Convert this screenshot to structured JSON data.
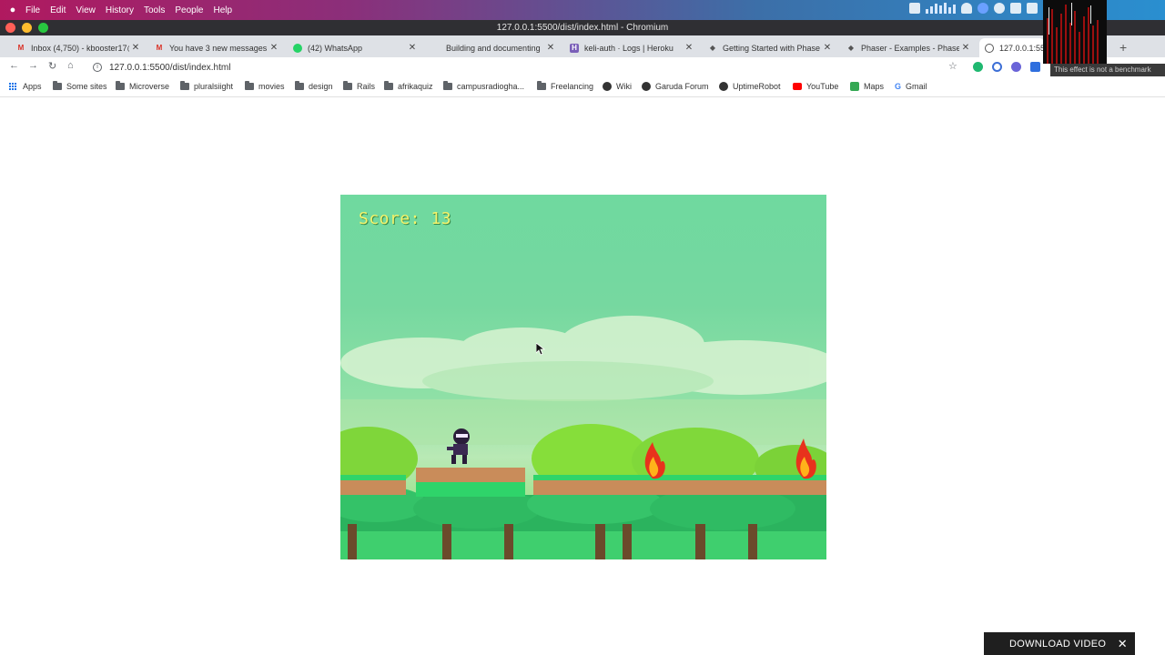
{
  "menubar": {
    "items": [
      "File",
      "Edit",
      "View",
      "History",
      "Tools",
      "People",
      "Help"
    ]
  },
  "window": {
    "title": "127.0.0.1:5500/dist/index.html - Chromium"
  },
  "tabs": [
    {
      "label": "Inbox (4,750) - kbooster17@",
      "icon": "gmail-icon"
    },
    {
      "label": "You have 3 new messages",
      "icon": "gmail-icon"
    },
    {
      "label": "(42) WhatsApp",
      "icon": "whatsapp-icon"
    },
    {
      "label": "Building and documenting",
      "icon": "blank-icon"
    },
    {
      "label": "keli-auth · Logs | Heroku",
      "icon": "heroku-icon"
    },
    {
      "label": "Getting Started with Phase",
      "icon": "phaser-icon"
    },
    {
      "label": "Phaser - Examples - Phaser",
      "icon": "phaser-icon"
    },
    {
      "label": "127.0.0.1:550",
      "icon": "globe-icon"
    }
  ],
  "toolbar": {
    "url": "127.0.0.1:5500/dist/index.html"
  },
  "bookmarks": [
    {
      "label": "Apps",
      "icon": "apps-grid-icon"
    },
    {
      "label": "Some sites",
      "icon": "folder-icon"
    },
    {
      "label": "Microverse",
      "icon": "folder-icon"
    },
    {
      "label": "pluralsiight",
      "icon": "folder-icon"
    },
    {
      "label": "movies",
      "icon": "folder-icon"
    },
    {
      "label": "design",
      "icon": "folder-icon"
    },
    {
      "label": "Rails",
      "icon": "folder-icon"
    },
    {
      "label": "afrikaquiz",
      "icon": "folder-icon"
    },
    {
      "label": "campusradiogha...",
      "icon": "folder-icon"
    },
    {
      "label": "Freelancing",
      "icon": "folder-icon"
    },
    {
      "label": "Wiki",
      "icon": "globe-icon"
    },
    {
      "label": "Garuda Forum",
      "icon": "globe-icon"
    },
    {
      "label": "UptimeRobot",
      "icon": "globe-icon"
    },
    {
      "label": "YouTube",
      "icon": "youtube-icon"
    },
    {
      "label": "Maps",
      "icon": "maps-icon"
    },
    {
      "label": "Gmail",
      "icon": "google-icon"
    }
  ],
  "game": {
    "score_text": "Score: 13"
  },
  "visualizer": {
    "tooltip": "This effect is not a benchmark"
  },
  "download": {
    "label": "DOWNLOAD VIDEO",
    "close": "✕"
  },
  "colors": {
    "sky": "#76d8a0",
    "score": "#f5f36b",
    "platform": "#c98c5a",
    "grass": "#2fd46a"
  }
}
